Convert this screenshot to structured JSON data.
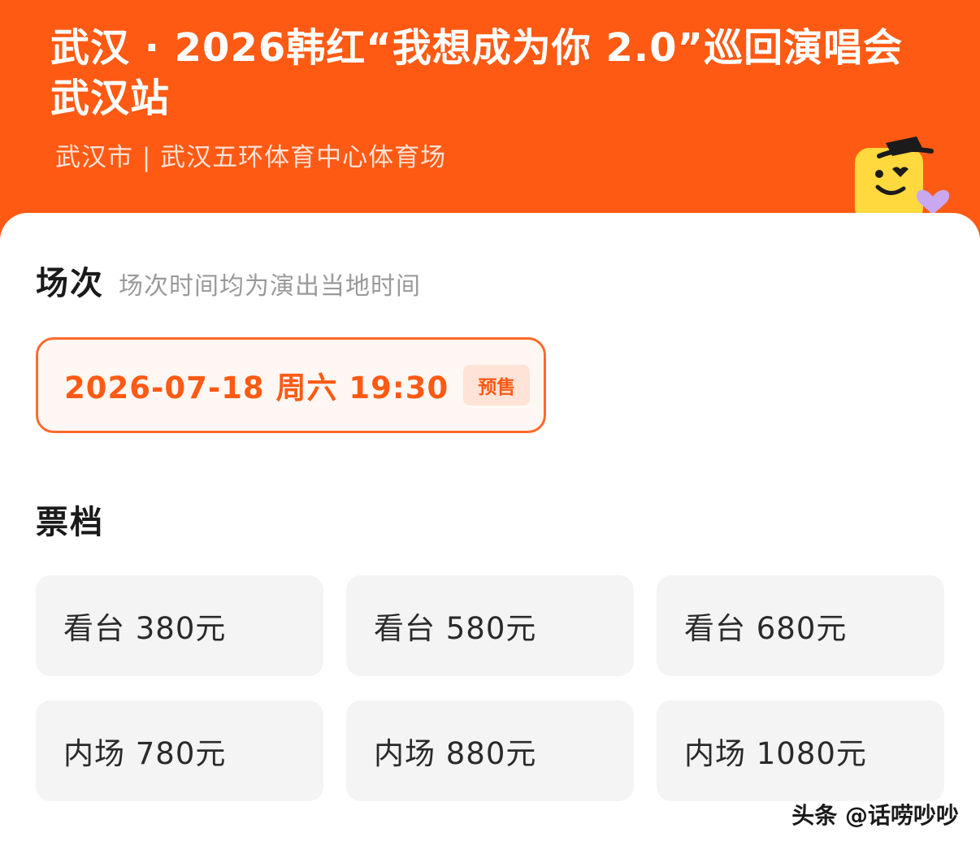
{
  "header": {
    "title": "武汉 · 2026韩红“我想成为你 2.0”巡回演唱会 武汉站",
    "subtitle": "武汉市 | 武汉五环体育中心体育场",
    "mascot": "yellow-smiley-mascot-with-hat-and-purple-heart"
  },
  "sessions": {
    "title": "场次",
    "note": "场次时间均为演出当地时间",
    "item": {
      "label": "2026-07-18  周六 19:30",
      "badge": "预售"
    }
  },
  "tiers": {
    "title": "票档",
    "items": [
      {
        "label": "看台 380元"
      },
      {
        "label": "看台 580元"
      },
      {
        "label": "看台 680元"
      },
      {
        "label": "内场 780元"
      },
      {
        "label": "内场 880元"
      },
      {
        "label": "内场 1080元"
      }
    ]
  },
  "watermark": "头条 @话唠吵吵",
  "colors": {
    "brand": "#ff5a14",
    "card": "#ffffff",
    "tier_bg": "#f4f4f4",
    "note": "#9a9a9a"
  }
}
